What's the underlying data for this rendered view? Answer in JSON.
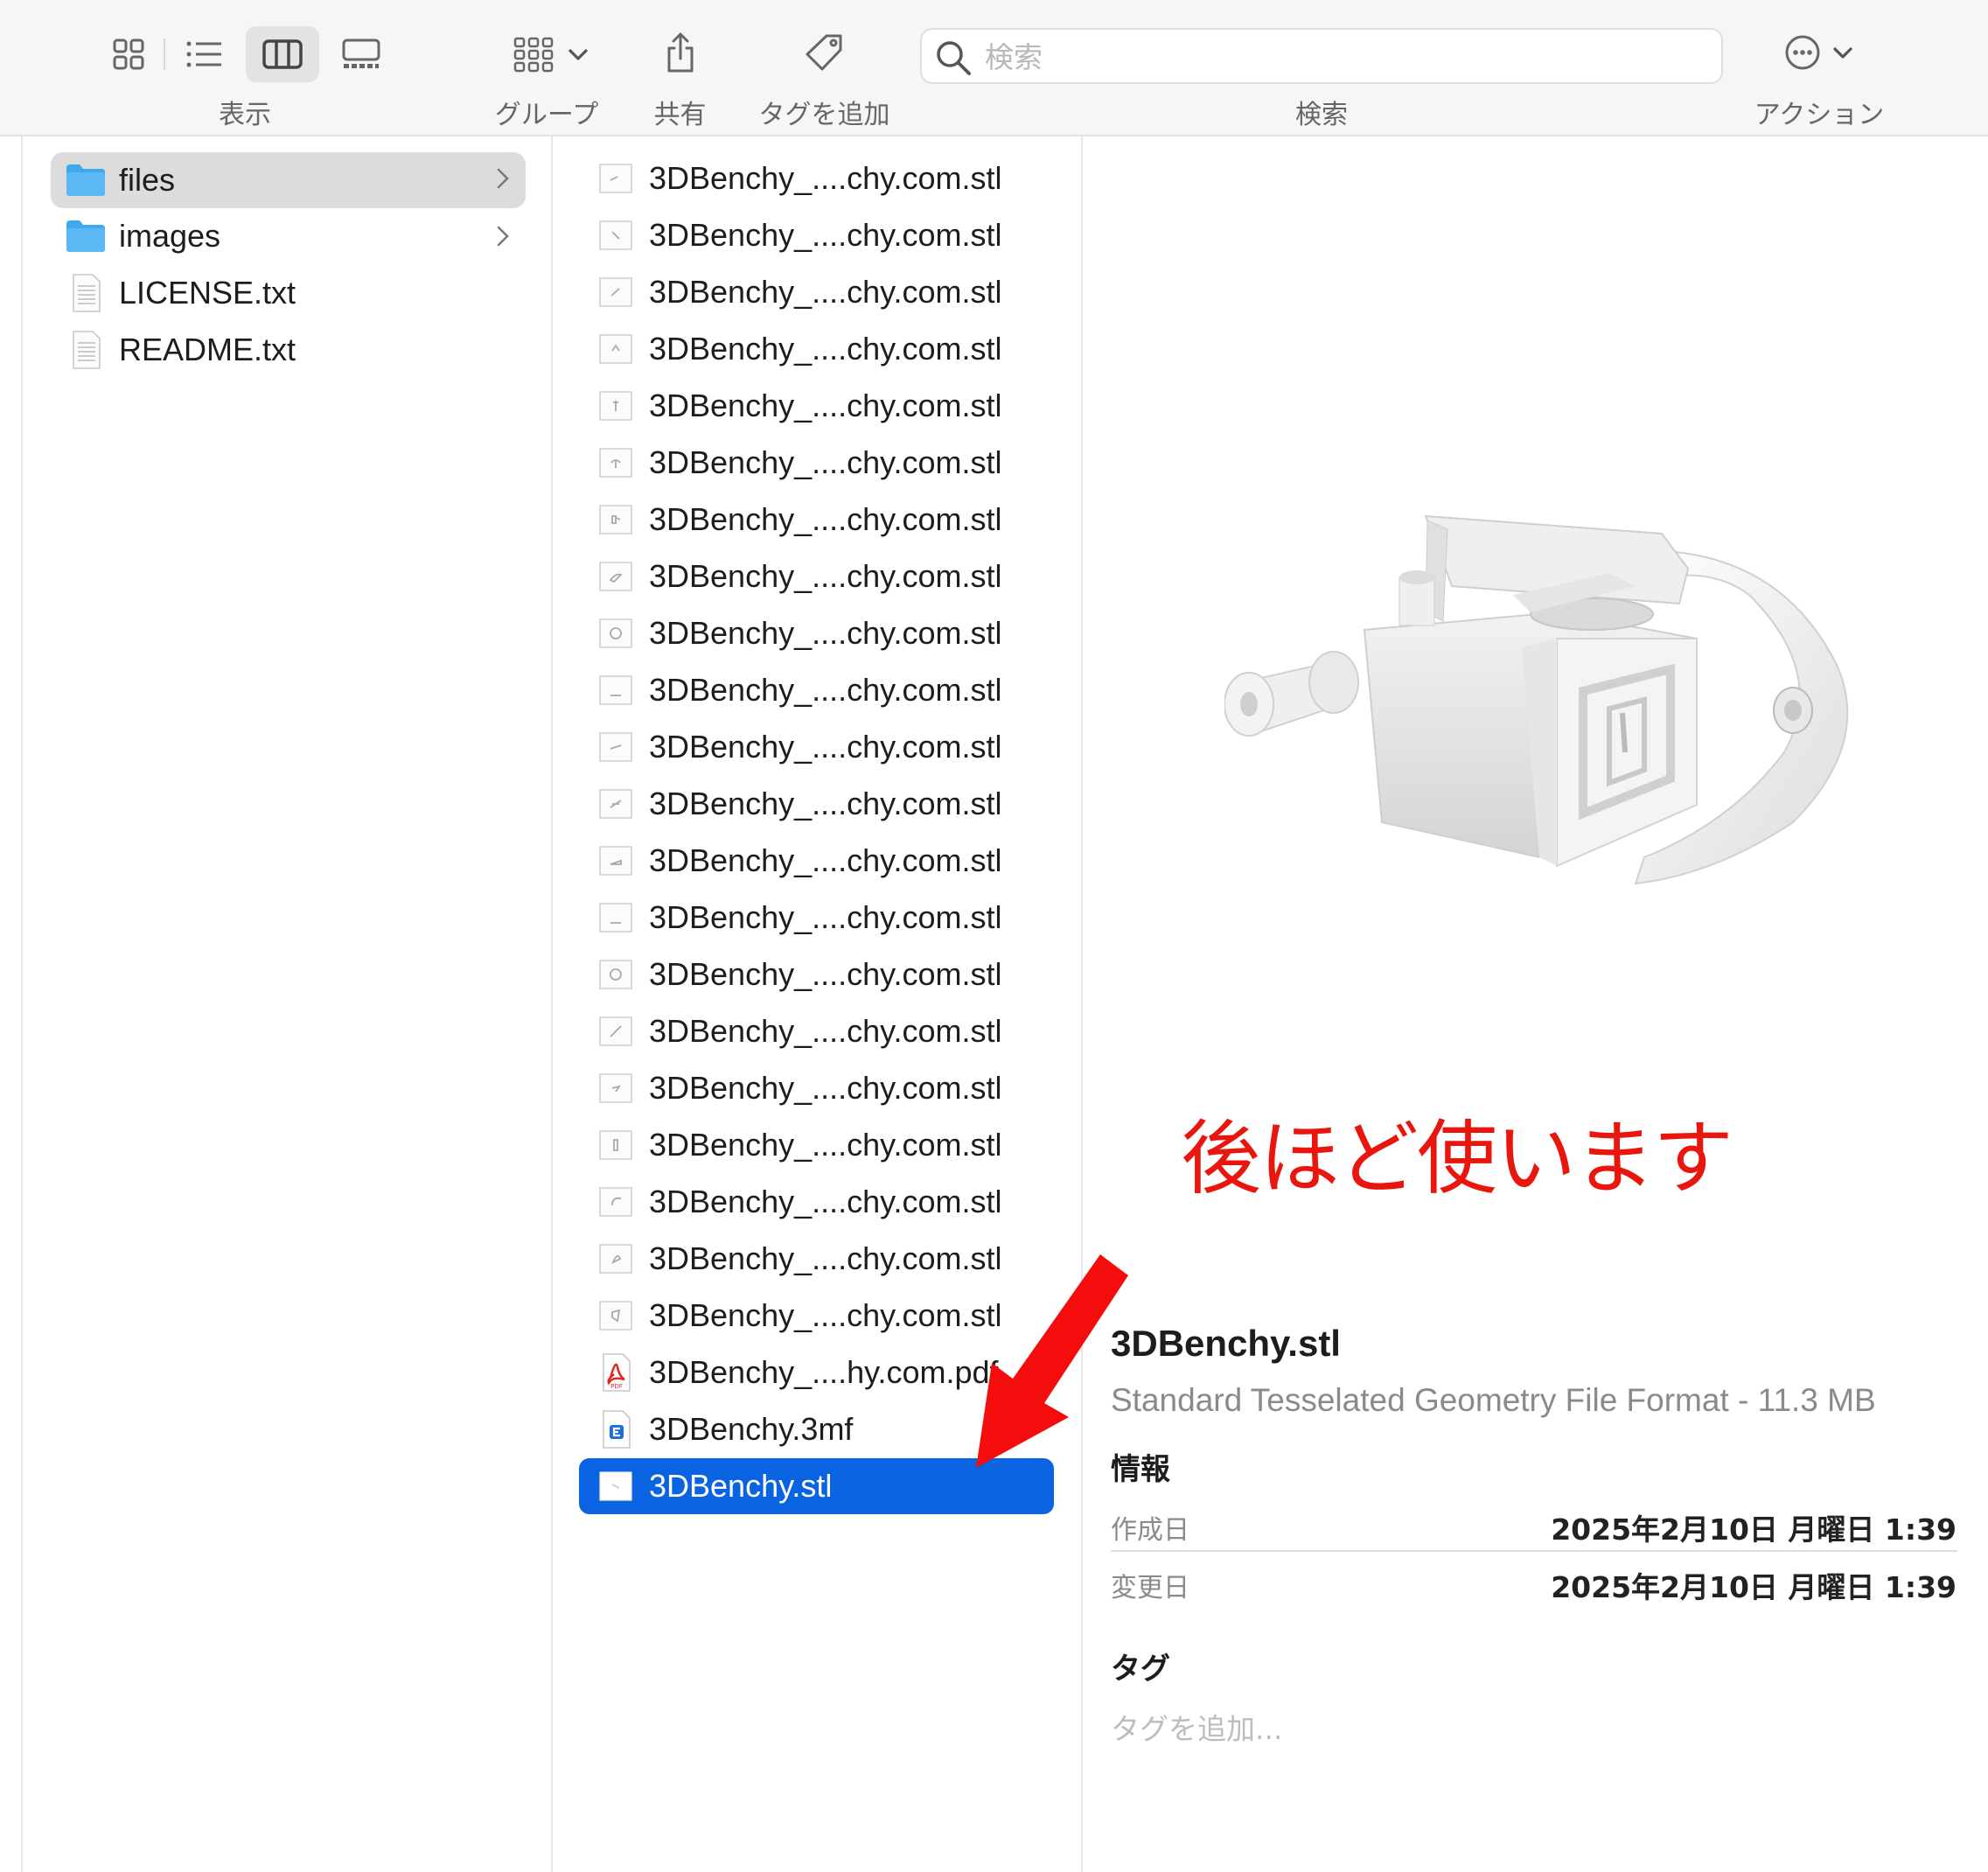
{
  "toolbar": {
    "view_label": "表示",
    "group_label": "グループ",
    "share_label": "共有",
    "tag_label": "タグを追加",
    "search_label": "検索",
    "search_placeholder": "検索",
    "action_label": "アクション"
  },
  "sidebar": {
    "items": [
      {
        "name": "files",
        "type": "folder",
        "selected": true,
        "has_children": true
      },
      {
        "name": "images",
        "type": "folder",
        "selected": false,
        "has_children": true
      },
      {
        "name": "LICENSE.txt",
        "type": "text"
      },
      {
        "name": "README.txt",
        "type": "text"
      }
    ]
  },
  "files": {
    "items": [
      {
        "name": "3DBenchy_....chy.com.stl",
        "type": "stl"
      },
      {
        "name": "3DBenchy_....chy.com.stl",
        "type": "stl"
      },
      {
        "name": "3DBenchy_....chy.com.stl",
        "type": "stl"
      },
      {
        "name": "3DBenchy_....chy.com.stl",
        "type": "stl"
      },
      {
        "name": "3DBenchy_....chy.com.stl",
        "type": "stl"
      },
      {
        "name": "3DBenchy_....chy.com.stl",
        "type": "stl"
      },
      {
        "name": "3DBenchy_....chy.com.stl",
        "type": "stl"
      },
      {
        "name": "3DBenchy_....chy.com.stl",
        "type": "stl"
      },
      {
        "name": "3DBenchy_....chy.com.stl",
        "type": "stl"
      },
      {
        "name": "3DBenchy_....chy.com.stl",
        "type": "stl"
      },
      {
        "name": "3DBenchy_....chy.com.stl",
        "type": "stl"
      },
      {
        "name": "3DBenchy_....chy.com.stl",
        "type": "stl"
      },
      {
        "name": "3DBenchy_....chy.com.stl",
        "type": "stl"
      },
      {
        "name": "3DBenchy_....chy.com.stl",
        "type": "stl"
      },
      {
        "name": "3DBenchy_....chy.com.stl",
        "type": "stl"
      },
      {
        "name": "3DBenchy_....chy.com.stl",
        "type": "stl"
      },
      {
        "name": "3DBenchy_....chy.com.stl",
        "type": "stl"
      },
      {
        "name": "3DBenchy_....chy.com.stl",
        "type": "stl"
      },
      {
        "name": "3DBenchy_....chy.com.stl",
        "type": "stl"
      },
      {
        "name": "3DBenchy_....chy.com.stl",
        "type": "stl"
      },
      {
        "name": "3DBenchy_....chy.com.stl",
        "type": "stl"
      },
      {
        "name": "3DBenchy_....hy.com.pdf",
        "type": "pdf"
      },
      {
        "name": "3DBenchy.3mf",
        "type": "3mf"
      },
      {
        "name": "3DBenchy.stl",
        "type": "stl",
        "selected": true
      }
    ]
  },
  "preview": {
    "file_name": "3DBenchy.stl",
    "file_kind": "Standard Tesselated Geometry File Format - 11.3 MB",
    "info_title": "情報",
    "created_label": "作成日",
    "created_value": "2025年2月10日 月曜日 1:39",
    "modified_label": "変更日",
    "modified_value": "2025年2月10日 月曜日 1:39",
    "tags_title": "タグ",
    "tags_placeholder": "タグを追加..."
  },
  "annotation": {
    "text": "後ほど使います",
    "color": "#e8160c"
  },
  "colors": {
    "selection_blue": "#0a63e0",
    "folder_blue": "#3fa8ef"
  }
}
